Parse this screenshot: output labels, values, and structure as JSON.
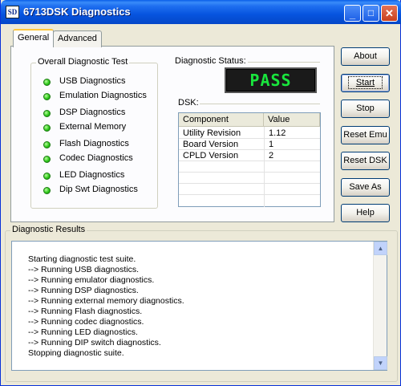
{
  "window": {
    "app_icon_text": "SD",
    "title": "6713DSK Diagnostics"
  },
  "tabs": [
    {
      "label": "General"
    },
    {
      "label": "Advanced"
    }
  ],
  "overall_test": {
    "legend": "Overall Diagnostic Test",
    "items": [
      {
        "label": "USB Diagnostics",
        "status_color": "#2fc81b"
      },
      {
        "label": "Emulation Diagnostics",
        "status_color": "#2fc81b"
      },
      {
        "label": "DSP Diagnostics",
        "status_color": "#2fc81b"
      },
      {
        "label": "External Memory",
        "status_color": "#2fc81b"
      },
      {
        "label": "Flash Diagnostics",
        "status_color": "#2fc81b"
      },
      {
        "label": "Codec Diagnostics",
        "status_color": "#2fc81b"
      },
      {
        "label": "LED Diagnostics",
        "status_color": "#2fc81b"
      },
      {
        "label": "Dip Swt Diagnostics",
        "status_color": "#2fc81b"
      }
    ]
  },
  "diagnostic_status": {
    "label": "Diagnostic Status:",
    "value": "PASS"
  },
  "dsk": {
    "label": "DSK:",
    "columns": [
      "Component",
      "Value"
    ],
    "rows": [
      {
        "component": "Utility Revision",
        "value": "1.12"
      },
      {
        "component": "Board Version",
        "value": "1"
      },
      {
        "component": "CPLD Version",
        "value": "2"
      }
    ]
  },
  "buttons": {
    "about": "About",
    "start": "Start",
    "stop": "Stop",
    "reset_emu": "Reset Emu",
    "reset_dsk": "Reset DSK",
    "save_as": "Save As",
    "help": "Help"
  },
  "results": {
    "legend": "Diagnostic Results",
    "lines": [
      "Starting diagnostic test suite.",
      "--> Running USB diagnostics.",
      "--> Running emulator diagnostics.",
      "--> Running DSP diagnostics.",
      "--> Running external memory diagnostics.",
      "--> Running Flash diagnostics.",
      "--> Running codec diagnostics.",
      "--> Running LED diagnostics.",
      "--> Running DIP switch diagnostics.",
      "Stopping diagnostic suite."
    ]
  }
}
